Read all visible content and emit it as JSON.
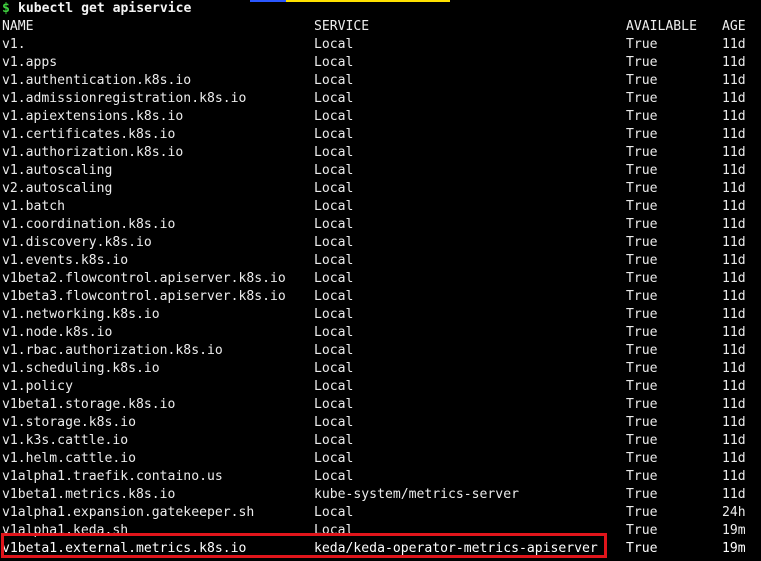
{
  "terminal": {
    "prompt_symbol": "$",
    "command": "kubectl get apiservice",
    "accent_colors": {
      "prompt": "#3fd13f",
      "highlight_border": "#e0151b"
    },
    "headers": [
      "NAME",
      "SERVICE",
      "AVAILABLE",
      "AGE"
    ],
    "rows": [
      {
        "name": "v1.",
        "service": "Local",
        "available": "True",
        "age": "11d"
      },
      {
        "name": "v1.apps",
        "service": "Local",
        "available": "True",
        "age": "11d"
      },
      {
        "name": "v1.authentication.k8s.io",
        "service": "Local",
        "available": "True",
        "age": "11d"
      },
      {
        "name": "v1.admissionregistration.k8s.io",
        "service": "Local",
        "available": "True",
        "age": "11d"
      },
      {
        "name": "v1.apiextensions.k8s.io",
        "service": "Local",
        "available": "True",
        "age": "11d"
      },
      {
        "name": "v1.certificates.k8s.io",
        "service": "Local",
        "available": "True",
        "age": "11d"
      },
      {
        "name": "v1.authorization.k8s.io",
        "service": "Local",
        "available": "True",
        "age": "11d"
      },
      {
        "name": "v1.autoscaling",
        "service": "Local",
        "available": "True",
        "age": "11d"
      },
      {
        "name": "v2.autoscaling",
        "service": "Local",
        "available": "True",
        "age": "11d"
      },
      {
        "name": "v1.batch",
        "service": "Local",
        "available": "True",
        "age": "11d"
      },
      {
        "name": "v1.coordination.k8s.io",
        "service": "Local",
        "available": "True",
        "age": "11d"
      },
      {
        "name": "v1.discovery.k8s.io",
        "service": "Local",
        "available": "True",
        "age": "11d"
      },
      {
        "name": "v1.events.k8s.io",
        "service": "Local",
        "available": "True",
        "age": "11d"
      },
      {
        "name": "v1beta2.flowcontrol.apiserver.k8s.io",
        "service": "Local",
        "available": "True",
        "age": "11d"
      },
      {
        "name": "v1beta3.flowcontrol.apiserver.k8s.io",
        "service": "Local",
        "available": "True",
        "age": "11d"
      },
      {
        "name": "v1.networking.k8s.io",
        "service": "Local",
        "available": "True",
        "age": "11d"
      },
      {
        "name": "v1.node.k8s.io",
        "service": "Local",
        "available": "True",
        "age": "11d"
      },
      {
        "name": "v1.rbac.authorization.k8s.io",
        "service": "Local",
        "available": "True",
        "age": "11d"
      },
      {
        "name": "v1.scheduling.k8s.io",
        "service": "Local",
        "available": "True",
        "age": "11d"
      },
      {
        "name": "v1.policy",
        "service": "Local",
        "available": "True",
        "age": "11d"
      },
      {
        "name": "v1beta1.storage.k8s.io",
        "service": "Local",
        "available": "True",
        "age": "11d"
      },
      {
        "name": "v1.storage.k8s.io",
        "service": "Local",
        "available": "True",
        "age": "11d"
      },
      {
        "name": "v1.k3s.cattle.io",
        "service": "Local",
        "available": "True",
        "age": "11d"
      },
      {
        "name": "v1.helm.cattle.io",
        "service": "Local",
        "available": "True",
        "age": "11d"
      },
      {
        "name": "v1alpha1.traefik.containo.us",
        "service": "Local",
        "available": "True",
        "age": "11d"
      },
      {
        "name": "v1beta1.metrics.k8s.io",
        "service": "kube-system/metrics-server",
        "available": "True",
        "age": "11d"
      },
      {
        "name": "v1alpha1.expansion.gatekeeper.sh",
        "service": "Local",
        "available": "True",
        "age": "24h"
      },
      {
        "name": "v1alpha1.keda.sh",
        "service": "Local",
        "available": "True",
        "age": "19m"
      },
      {
        "name": "v1beta1.external.metrics.k8s.io",
        "service": "keda/keda-operator-metrics-apiserver",
        "available": "True",
        "age": "19m",
        "highlighted": true
      }
    ]
  }
}
